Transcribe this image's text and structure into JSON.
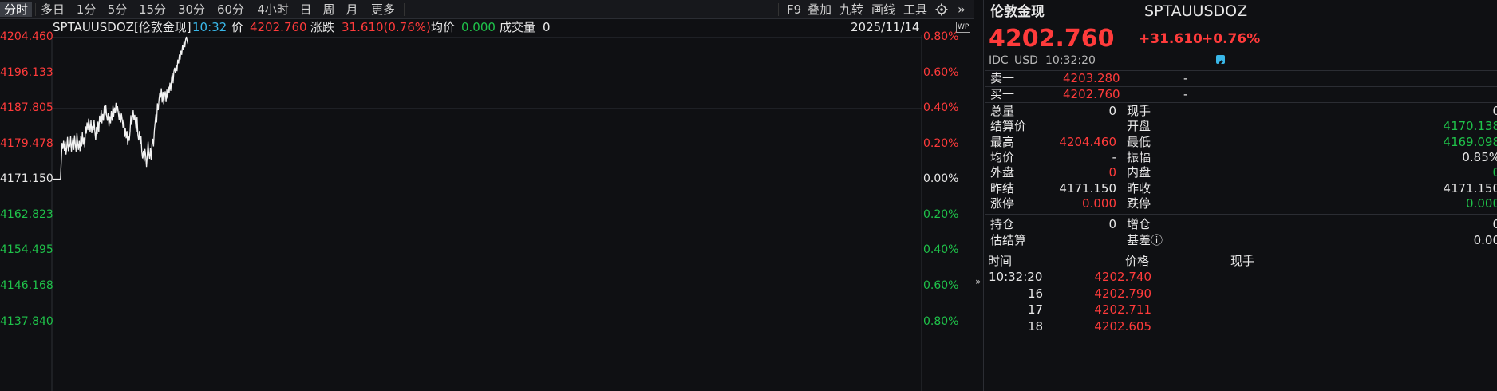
{
  "tabs": [
    {
      "label": "分时",
      "active": true
    },
    {
      "label": "多日"
    },
    {
      "label": "1分"
    },
    {
      "label": "5分"
    },
    {
      "label": "15分"
    },
    {
      "label": "30分"
    },
    {
      "label": "60分"
    },
    {
      "label": "4小时"
    },
    {
      "label": "日"
    },
    {
      "label": "周"
    },
    {
      "label": "月"
    },
    {
      "label": "更多"
    }
  ],
  "tools": {
    "f9": "F9",
    "overlay": "叠加",
    "nine": "九转",
    "draw": "画线",
    "tools": "工具",
    "collapse": "»"
  },
  "info": {
    "symbol": "SPTAUUSDOZ[伦敦金现]",
    "time": "10:32",
    "price_label": "价",
    "price": "4202.760",
    "change_label": "涨跌",
    "change": "31.610(0.76%)",
    "avg_label": "均价",
    "avg": "0.000",
    "vol_label": "成交量",
    "vol": "0",
    "date": "2025/11/14",
    "wp": "WP"
  },
  "axes": {
    "left": [
      "4204.460",
      "4196.133",
      "4187.805",
      "4179.478",
      "4171.150",
      "4162.823",
      "4154.495",
      "4146.168",
      "4137.840"
    ],
    "right": [
      "0.80%",
      "0.60%",
      "0.40%",
      "0.20%",
      "0.00%",
      "0.20%",
      "0.40%",
      "0.60%",
      "0.80%"
    ]
  },
  "chart_data": {
    "type": "line",
    "title": "",
    "xlabel": "",
    "ylabel": "",
    "ylim": [
      4137.84,
      4204.46
    ],
    "prev_close": 4171.15,
    "x_steps": [
      0,
      9,
      10,
      11,
      12,
      13,
      14,
      15,
      16,
      17,
      18,
      19,
      20,
      21,
      22,
      23,
      24,
      25,
      26,
      27,
      28,
      29,
      30,
      31,
      32,
      33,
      34,
      35,
      36,
      37,
      38,
      39,
      40,
      41,
      42,
      43,
      44,
      45,
      46,
      47,
      48,
      49,
      50,
      51,
      52,
      53,
      54,
      55,
      56,
      57,
      58,
      59,
      60,
      61,
      62,
      63,
      64,
      65,
      66,
      67,
      68,
      69,
      70,
      71,
      72,
      73,
      74,
      75,
      76,
      77,
      78,
      79,
      80,
      81,
      82,
      83,
      84,
      85,
      86,
      87,
      88,
      89,
      90,
      91,
      92,
      93,
      94,
      95,
      96,
      97,
      98,
      99,
      100,
      101,
      102,
      103,
      104,
      105,
      106,
      107,
      108,
      109,
      110,
      111,
      112,
      113,
      114,
      115,
      116,
      117,
      118,
      119,
      120,
      121,
      122,
      123,
      124,
      125,
      126,
      127,
      128,
      129,
      130,
      131,
      132,
      133,
      134,
      135,
      136,
      137,
      138,
      139,
      140,
      141,
      142,
      143,
      144,
      145,
      146,
      147,
      148,
      149,
      150,
      151,
      152,
      153,
      154,
      155,
      156,
      157,
      158,
      159,
      160,
      161,
      162,
      163,
      164,
      165,
      166,
      167,
      168,
      169,
      170,
      171,
      172,
      173,
      174,
      175,
      176,
      177,
      178,
      179,
      180,
      181,
      182,
      183,
      184,
      185,
      186,
      187,
      188,
      189,
      190,
      191,
      192,
      193,
      194,
      195,
      196,
      197,
      198,
      199,
      200,
      201,
      202,
      203,
      204,
      205,
      206,
      207,
      208,
      209,
      210
    ],
    "values": [
      4171.15,
      4171.15,
      4171.2,
      4175.5,
      4179.6,
      4178.2,
      4180.1,
      4177.8,
      4179.9,
      4176.9,
      4178.4,
      4181.0,
      4177.7,
      4179.2,
      4178.9,
      4181.3,
      4177.6,
      4179.6,
      4180.8,
      4178.0,
      4181.4,
      4179.2,
      4177.6,
      4181.9,
      4179.5,
      4178.0,
      4180.1,
      4177.7,
      4181.3,
      4178.8,
      4182.1,
      4179.2,
      4180.9,
      4178.6,
      4183.5,
      4181.8,
      4184.4,
      4182.6,
      4185.3,
      4183.7,
      4182.1,
      4184.9,
      4181.9,
      4183.6,
      4182.6,
      4185.0,
      4182.2,
      4180.2,
      4183.4,
      4181.7,
      4184.6,
      4182.2,
      4186.0,
      4184.5,
      4187.3,
      4184.2,
      4186.4,
      4184.8,
      4188.3,
      4186.1,
      4188.5,
      4186.0,
      4184.8,
      4186.7,
      4183.5,
      4185.9,
      4184.2,
      4187.1,
      4184.8,
      4188.3,
      4185.8,
      4187.9,
      4186.6,
      4189.0,
      4186.8,
      4188.2,
      4186.7,
      4185.0,
      4187.1,
      4184.4,
      4186.5,
      4185.0,
      4183.2,
      4185.1,
      4181.0,
      4183.0,
      4180.7,
      4182.4,
      4179.1,
      4181.1,
      4180.1,
      4182.3,
      4186.1,
      4183.8,
      4185.5,
      4187.3,
      4184.9,
      4186.2,
      4184.0,
      4182.2,
      4185.7,
      4181.5,
      4180.2,
      4182.4,
      4179.3,
      4181.3,
      4177.6,
      4176.0,
      4177.8,
      4175.3,
      4178.2,
      4176.7,
      4174.0,
      4176.7,
      4179.9,
      4177.1,
      4175.9,
      4178.4,
      4175.6,
      4179.4,
      4180.6,
      4178.8,
      4182.4,
      4184.4,
      4186.3,
      4184.4,
      4188.9,
      4187.3,
      4189.8,
      4191.4,
      4190.2,
      4192.4,
      4189.1,
      4191.6,
      4188.7,
      4190.8,
      4191.7,
      4189.2,
      4192.1,
      4190.0,
      4192.8,
      4191.4,
      4193.7,
      4191.8,
      4194.7,
      4195.9,
      4193.6,
      4196.3,
      4197.2,
      4195.9,
      4197.8,
      4196.4,
      4199.1,
      4198.2,
      4200.3,
      4199.1,
      4201.2,
      4200.2,
      4202.4,
      4201.3,
      4203.3,
      4202.0,
      4203.8,
      4204.46,
      4203.4,
      4202.76
    ]
  },
  "quote": {
    "name": "伦敦金现",
    "code": "SPTAUUSDOZ",
    "last": "4202.760",
    "chg": "+31.610",
    "pct": "+0.76%",
    "source": "IDC",
    "currency": "USD",
    "time": "10:32:20",
    "edit_icon": "pencil-icon",
    "sell_label": "卖一",
    "sell_price": "4203.280",
    "sell_vol": "-",
    "buy_label": "买一",
    "buy_price": "4202.760",
    "buy_vol": "-",
    "rows": [
      {
        "l1": "总量",
        "v1": "0",
        "c1": "white",
        "l2": "现手",
        "v2": "0",
        "c2": "white"
      },
      {
        "l1": "结算价",
        "v1": "",
        "c1": "white",
        "l2": "开盘",
        "v2": "4170.138",
        "c2": "green"
      },
      {
        "l1": "最高",
        "v1": "4204.460",
        "c1": "red",
        "l2": "最低",
        "v2": "4169.098",
        "c2": "green"
      },
      {
        "l1": "均价",
        "v1": "-",
        "c1": "white",
        "l2": "振幅",
        "v2": "0.85%",
        "c2": "white"
      },
      {
        "l1": "外盘",
        "v1": "0",
        "c1": "red",
        "l2": "内盘",
        "v2": "0",
        "c2": "green"
      },
      {
        "l1": "昨结",
        "v1": "4171.150",
        "c1": "white",
        "l2": "昨收",
        "v2": "4171.150",
        "c2": "white"
      },
      {
        "l1": "涨停",
        "v1": "0.000",
        "c1": "red",
        "l2": "跌停",
        "v2": "0.000",
        "c2": "green"
      }
    ],
    "rows2": [
      {
        "l1": "持仓",
        "v1": "0",
        "c1": "white",
        "l2": "增仓",
        "v2": "0",
        "c2": "white"
      },
      {
        "l1": "估结算",
        "v1": "",
        "c1": "white",
        "l2": "基差ⓘ",
        "v2": "0.00",
        "c2": "white"
      }
    ],
    "ticks_header": {
      "time": "时间",
      "price": "价格",
      "vol": "现手"
    },
    "ticks": [
      {
        "time": "10:32:20",
        "price": "4202.740"
      },
      {
        "time": "16",
        "price": "4202.790"
      },
      {
        "time": "17",
        "price": "4202.711"
      },
      {
        "time": "18",
        "price": "4202.605"
      }
    ]
  }
}
